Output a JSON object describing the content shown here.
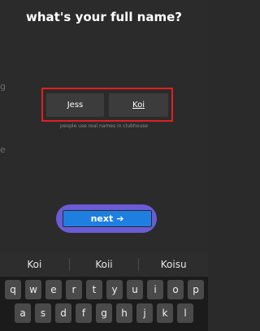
{
  "screen": {
    "title": "what's your full name?",
    "hint": "people use real names in clubhouse"
  },
  "form": {
    "first_name": "Jess",
    "last_name": "Koi"
  },
  "next_button": {
    "label": "next",
    "icon": "arrow-right-icon"
  },
  "suggestions": [
    "Koi",
    "Koii",
    "Koisu"
  ],
  "keyboard": {
    "row1": [
      "q",
      "w",
      "e",
      "r",
      "t",
      "y",
      "u",
      "i",
      "o",
      "p"
    ],
    "row2": [
      "a",
      "s",
      "d",
      "f",
      "g",
      "h",
      "j",
      "k",
      "l"
    ]
  },
  "colors": {
    "highlight_red": "#e02020",
    "button_blue": "#1e7fe0",
    "button_purple": "#6b5bd6"
  }
}
